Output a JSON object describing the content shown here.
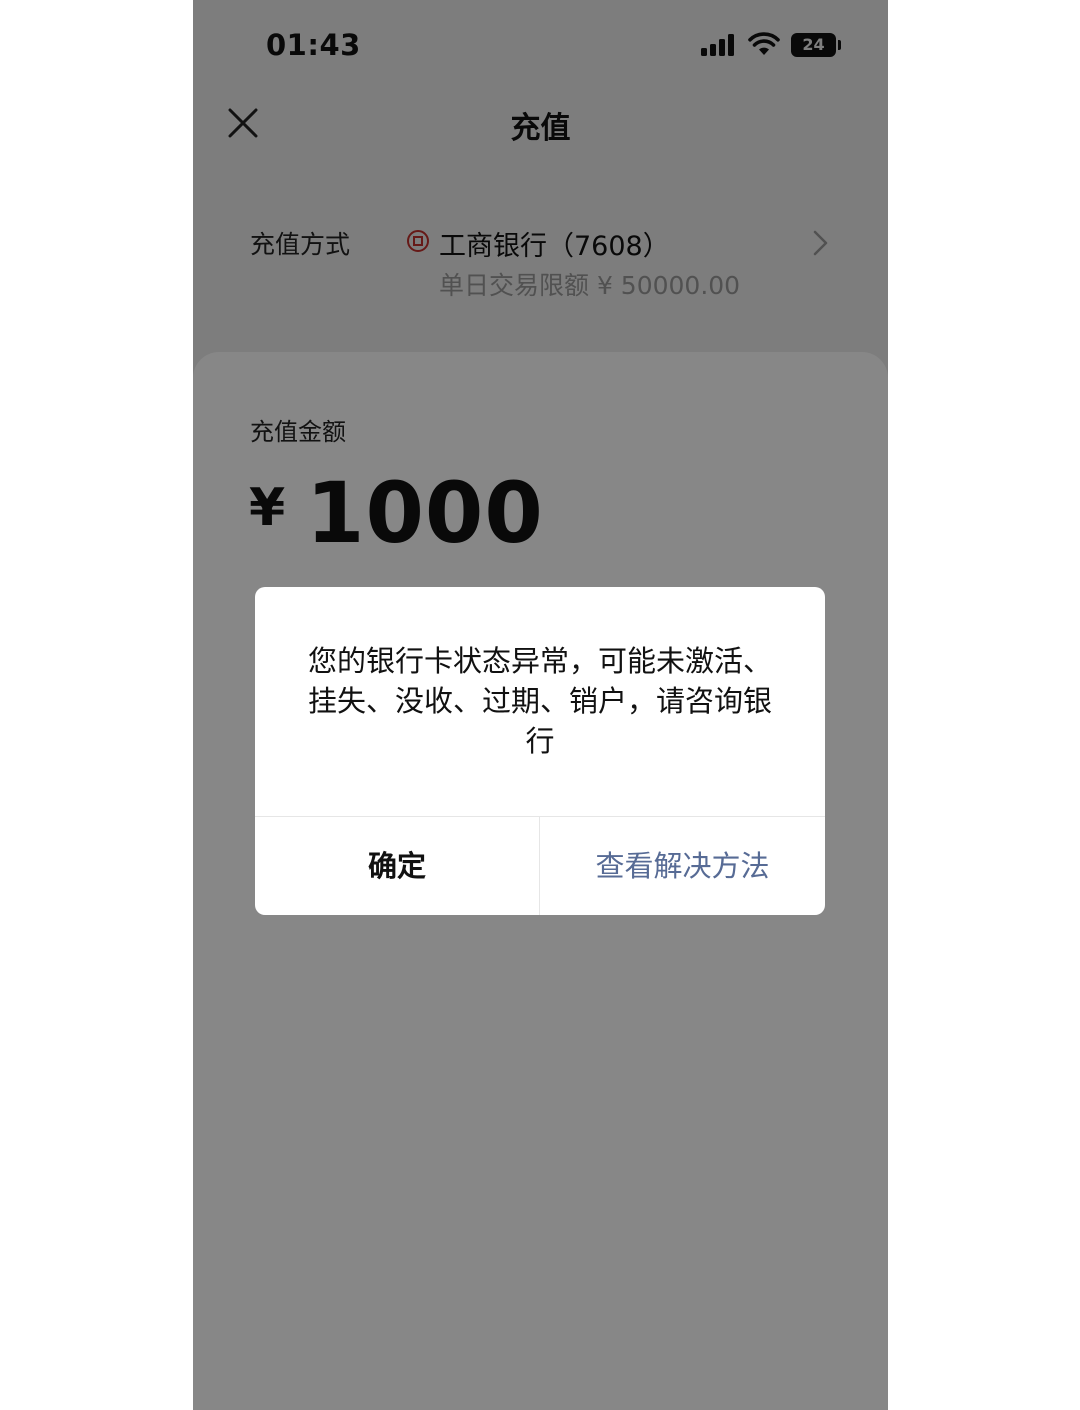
{
  "status_bar": {
    "time": "01:43",
    "battery": "24"
  },
  "header": {
    "title": "充值",
    "close_icon": "close-icon"
  },
  "payment_method": {
    "label": "充值方式",
    "bank_name": "工商银行（7608）",
    "daily_limit": "单日交易限额 ¥ 50000.00",
    "bank_icon_color": "#c0302c"
  },
  "amount": {
    "label": "充值金额",
    "currency": "¥",
    "value": "1000"
  },
  "dialog": {
    "message": "您的银行卡状态异常，可能未激活、挂失、没收、过期、销户，请咨询银行",
    "confirm_label": "确定",
    "solution_label": "查看解决方法",
    "link_color": "#576b95"
  }
}
